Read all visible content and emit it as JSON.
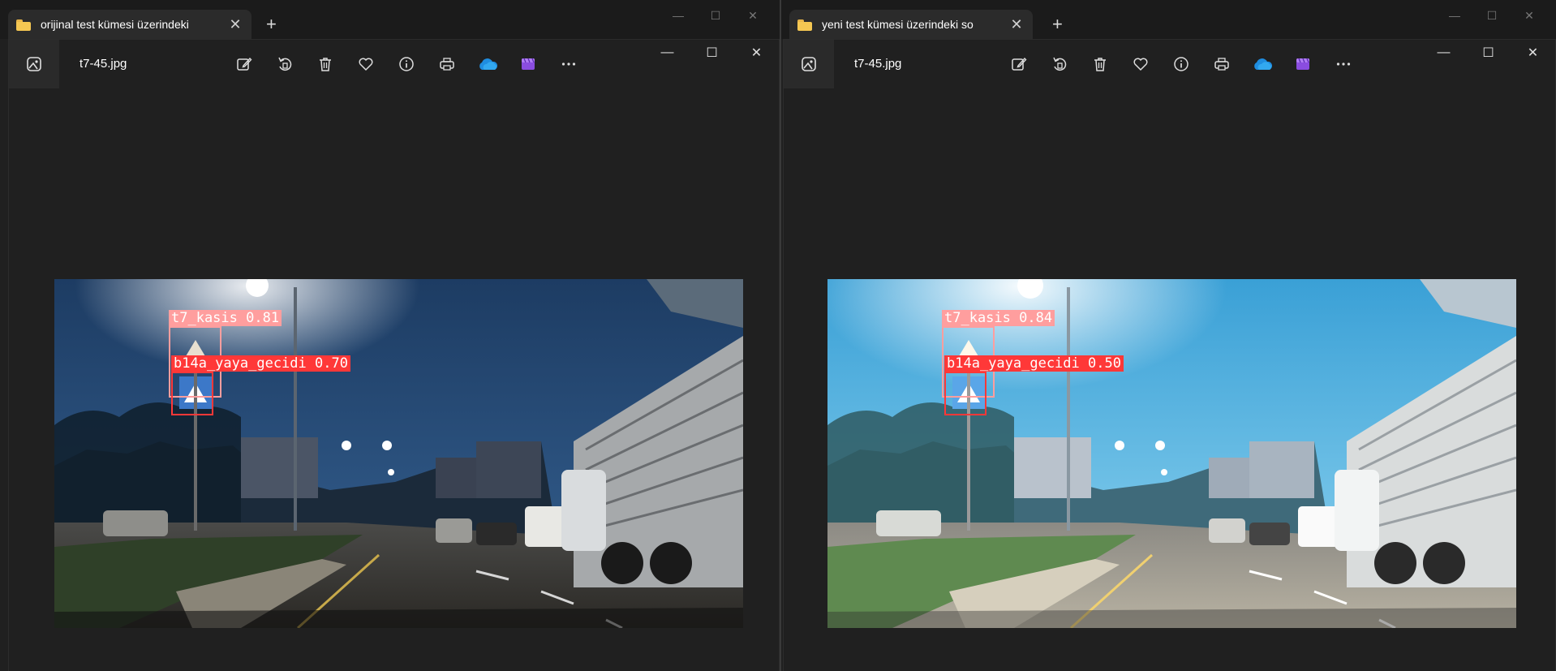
{
  "colors": {
    "folder": "#f5c752",
    "kasis_box": "#ff9e9e",
    "yaya_box": "#ff3838",
    "onedrive": "#1f8de0",
    "clipchamp": "#8a4de0"
  },
  "left": {
    "explorer_tab_title": "orijinal test kümesi üzerindeki",
    "new_tab": "+",
    "close_tab": "✕",
    "file_name": "t7-45.jpg",
    "detections": [
      {
        "label": "t7_kasis 0.81",
        "class": "t7_kasis",
        "confidence": 0.81
      },
      {
        "label": "b14a_yaya_gecidi 0.70",
        "class": "b14a_yaya_gecidi",
        "confidence": 0.7
      }
    ]
  },
  "right": {
    "explorer_tab_title": "yeni test kümesi üzerindeki so",
    "new_tab": "+",
    "close_tab": "✕",
    "file_name": "t7-45.jpg",
    "detections": [
      {
        "label": "t7_kasis 0.84",
        "class": "t7_kasis",
        "confidence": 0.84
      },
      {
        "label": "b14a_yaya_gecidi 0.50",
        "class": "b14a_yaya_gecidi",
        "confidence": 0.5
      }
    ]
  },
  "toolbar_icons": [
    "image-app-icon",
    "edit-icon",
    "rotate-icon",
    "delete-icon",
    "favorite-icon",
    "info-icon",
    "print-icon",
    "onedrive-icon",
    "clipchamp-icon",
    "more-icon"
  ],
  "window_controls": {
    "minimize": "—",
    "maximize": "☐",
    "close": "✕"
  }
}
